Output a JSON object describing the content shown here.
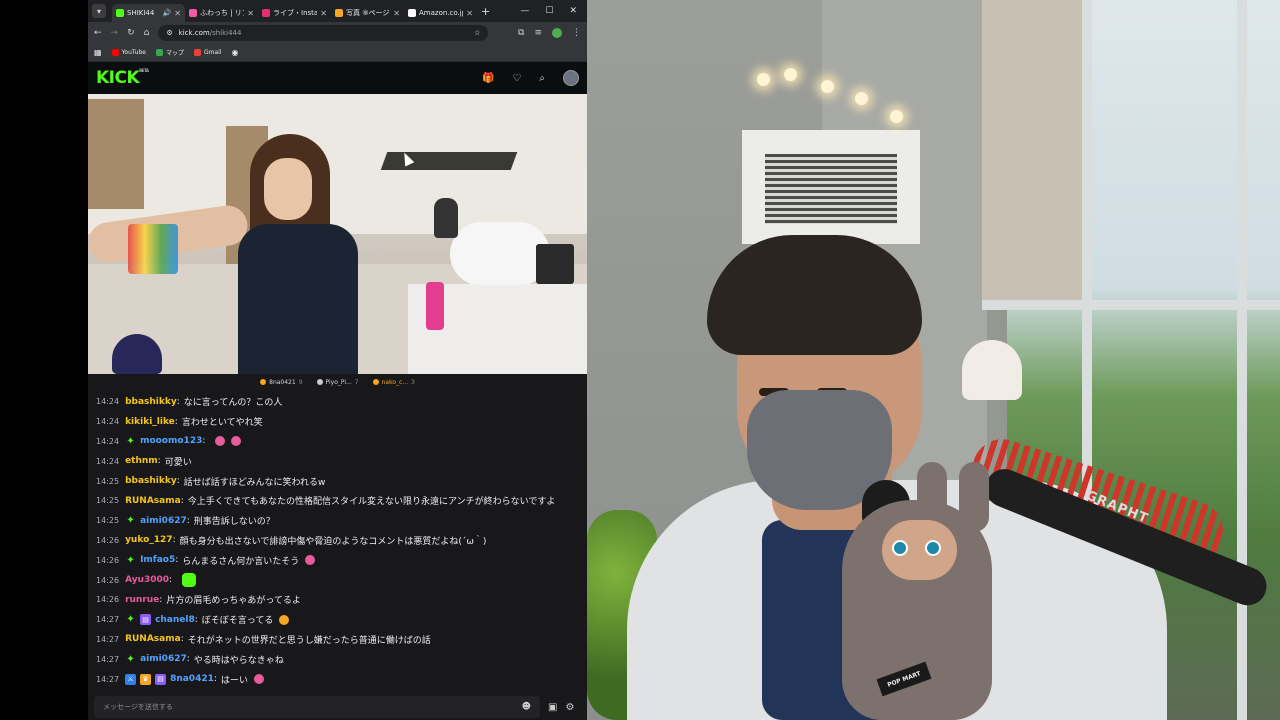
{
  "browser": {
    "tabs": [
      {
        "title": "SHIKI44",
        "active": true,
        "favicon_color": "#53fc18",
        "audio": true
      },
      {
        "title": "ふわっち | リア",
        "favicon_color": "#ef5da8"
      },
      {
        "title": "ライブ・Insta",
        "favicon_color": "#e1306c"
      },
      {
        "title": "写真 ⑨ページ",
        "favicon_color": "#f9a825"
      },
      {
        "title": "Amazon.co.jp",
        "favicon_color": "#222222"
      }
    ],
    "new_tab": "+",
    "url": "kick.com",
    "url_path": "/shiki444",
    "bookmarks": [
      {
        "label": "YouTube",
        "color": "#ff0000"
      },
      {
        "label": "マップ",
        "color": "#34a853"
      },
      {
        "label": "Gmail",
        "color": "#ea4335"
      }
    ]
  },
  "kick": {
    "logo": "KICK",
    "logo_sup": "BETA",
    "accent": "#53fc18"
  },
  "viewers_bar": [
    {
      "name": "8na0421",
      "rank": "9",
      "color": "#f5a623"
    },
    {
      "name": "Piyo_Pi...",
      "rank": "7",
      "color": "#cccccc"
    },
    {
      "name": "nako_c...",
      "rank": "3",
      "color": "#f5a623"
    }
  ],
  "chat": {
    "messages": [
      {
        "time": "14:24",
        "user": "bbashikky",
        "color": "#f5c518",
        "badges": [],
        "text": "なに言ってんの？この人",
        "emotes": []
      },
      {
        "time": "14:24",
        "user": "kikiki_like",
        "color": "#f5c518",
        "badges": [],
        "text": "言わせといてやれ笑",
        "emotes": []
      },
      {
        "time": "14:24",
        "user": "mooomo123",
        "color": "#4fa3ff",
        "badges": [
          "sub"
        ],
        "text": "",
        "emotes": [
          "pink",
          "pink"
        ]
      },
      {
        "time": "14:24",
        "user": "ethnm",
        "color": "#f5c518",
        "badges": [],
        "text": "可愛い",
        "emotes": []
      },
      {
        "time": "14:25",
        "user": "bbashikky",
        "color": "#f5c518",
        "badges": [],
        "text": "話せば話すほどみんなに笑われるw",
        "emotes": []
      },
      {
        "time": "14:25",
        "user": "RUNAsama",
        "color": "#f5c518",
        "badges": [],
        "text": "今上手くできてもあなたの性格配信スタイル変えない限り永遠にアンチが終わらないですよ",
        "emotes": []
      },
      {
        "time": "14:25",
        "user": "aimi0627",
        "color": "#4fa3ff",
        "badges": [
          "sub"
        ],
        "text": "刑事告訴しないの？",
        "emotes": []
      },
      {
        "time": "14:26",
        "user": "yuko_127",
        "color": "#f5c518",
        "badges": [],
        "text": "顔も身分も出さないで誹謗中傷や脅迫のようなコメントは悪質だよね(´ω｀)",
        "emotes": []
      },
      {
        "time": "14:26",
        "user": "Imfao5",
        "color": "#4fa3ff",
        "badges": [
          "sub"
        ],
        "text": "らんまるさん何か言いたそう",
        "emotes": [
          "pink"
        ]
      },
      {
        "time": "14:26",
        "user": "Ayu3000",
        "color": "#e85b9c",
        "badges": [],
        "text": "",
        "emotes": [
          "green"
        ]
      },
      {
        "time": "14:26",
        "user": "runrue",
        "color": "#e85b9c",
        "badges": [],
        "text": "片方の眉毛めっちゃあがってるよ",
        "emotes": []
      },
      {
        "time": "14:27",
        "user": "chanel8",
        "color": "#4fa3ff",
        "badges": [
          "sub",
          "gift"
        ],
        "text": "ぼそぼそ言ってる",
        "emotes": [
          "orange"
        ]
      },
      {
        "time": "14:27",
        "user": "RUNAsama",
        "color": "#f5c518",
        "badges": [],
        "text": "それがネットの世界だと思うし嫌だったら普通に働けばの話",
        "emotes": []
      },
      {
        "time": "14:27",
        "user": "aimi0627",
        "color": "#4fa3ff",
        "badges": [
          "sub"
        ],
        "text": "やる時はやらなきゃね",
        "emotes": []
      },
      {
        "time": "14:27",
        "user": "8na0421",
        "color": "#4fa3ff",
        "badges": [
          "mod",
          "crown",
          "gift"
        ],
        "text": "はーい",
        "emotes": [
          "pink"
        ]
      }
    ],
    "input_placeholder": "メッセージを送信する"
  },
  "webcam": {
    "overlay_text": "GRAPHT",
    "merch_text": "POP MART"
  }
}
